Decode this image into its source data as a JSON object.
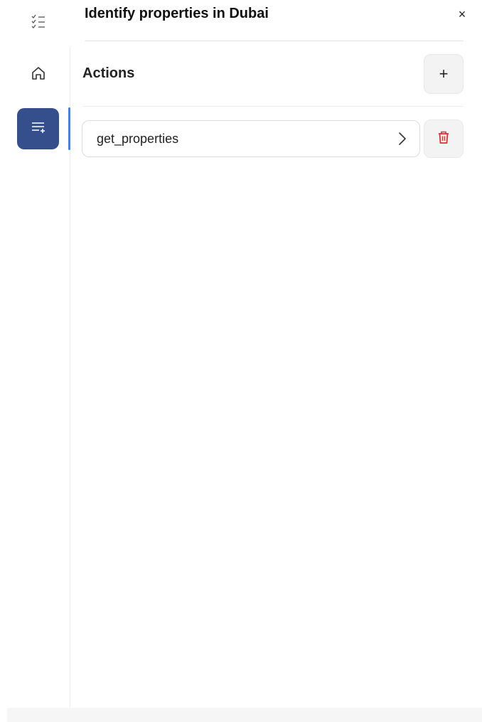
{
  "header": {
    "title": "Identify properties in Dubai",
    "close_label": "×"
  },
  "sidebar": {
    "items": [
      {
        "name": "tasks",
        "icon": "checklist-icon",
        "active": false
      },
      {
        "name": "home",
        "icon": "home-icon",
        "active": false
      },
      {
        "name": "actions",
        "icon": "list-add-icon",
        "active": true
      }
    ],
    "active_color": "#344f8c",
    "indicator_color": "#3b82f6"
  },
  "actions_panel": {
    "title": "Actions",
    "add_label": "+",
    "items": [
      {
        "name": "get_properties",
        "delete_color": "#e03131"
      }
    ]
  }
}
